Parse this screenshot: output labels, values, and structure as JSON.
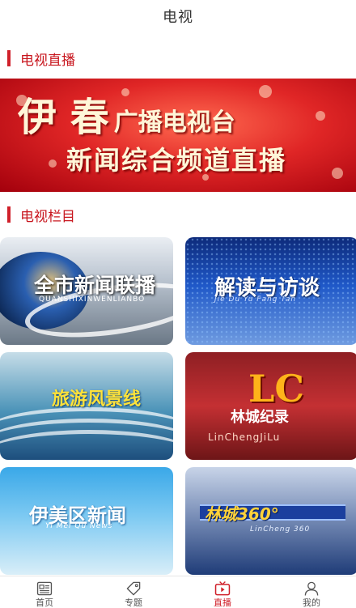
{
  "header": {
    "title": "电视"
  },
  "sections": {
    "live": {
      "label": "电视直播"
    },
    "programs": {
      "label": "电视栏目"
    }
  },
  "live_banner": {
    "line1_big": "伊 春",
    "line1_small": "广播电视台",
    "line2": "新闻综合频道直播"
  },
  "programs": [
    {
      "title": "全市新闻联播",
      "subtitle": "QUANSHIXINWENLIANBO"
    },
    {
      "title": "解读与访谈",
      "subtitle": "Jie Du Yu Fang Tan"
    },
    {
      "title": "旅游风景线",
      "subtitle": ""
    },
    {
      "title": "林城纪录",
      "logo": "LC",
      "subtitle": "LinChengJiLu"
    },
    {
      "title": "伊美区新闻",
      "subtitle": "Yi Mei Qu News"
    },
    {
      "title": "林城360°",
      "subtitle": "LinCheng 360"
    }
  ],
  "tabbar": {
    "items": [
      {
        "label": "首页",
        "icon": "news-icon"
      },
      {
        "label": "专题",
        "icon": "tag-icon"
      },
      {
        "label": "直播",
        "icon": "tv-icon",
        "active": true
      },
      {
        "label": "我的",
        "icon": "person-icon"
      }
    ]
  },
  "colors": {
    "accent": "#d0202a"
  }
}
